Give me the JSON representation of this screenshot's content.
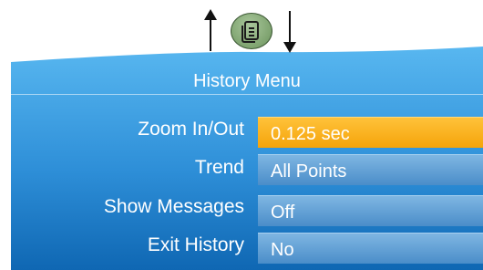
{
  "screen": {
    "title": "History Menu",
    "colors": {
      "panel_top": "#58b7f0",
      "panel_bottom": "#0f67b3",
      "field": "#5b9ed6",
      "field_selected": "#f7a81b"
    }
  },
  "nav": {
    "up_icon": "arrow-up-icon",
    "down_icon": "arrow-down-icon",
    "menu_key_icon": "document-icon"
  },
  "menu": {
    "rows": [
      {
        "label": "Zoom In/Out",
        "value": "0.125 sec",
        "selected": true
      },
      {
        "label": "Trend",
        "value": "All Points",
        "selected": false
      },
      {
        "label": "Show Messages",
        "value": "Off",
        "selected": false
      },
      {
        "label": "Exit History",
        "value": "No",
        "selected": false
      }
    ]
  }
}
